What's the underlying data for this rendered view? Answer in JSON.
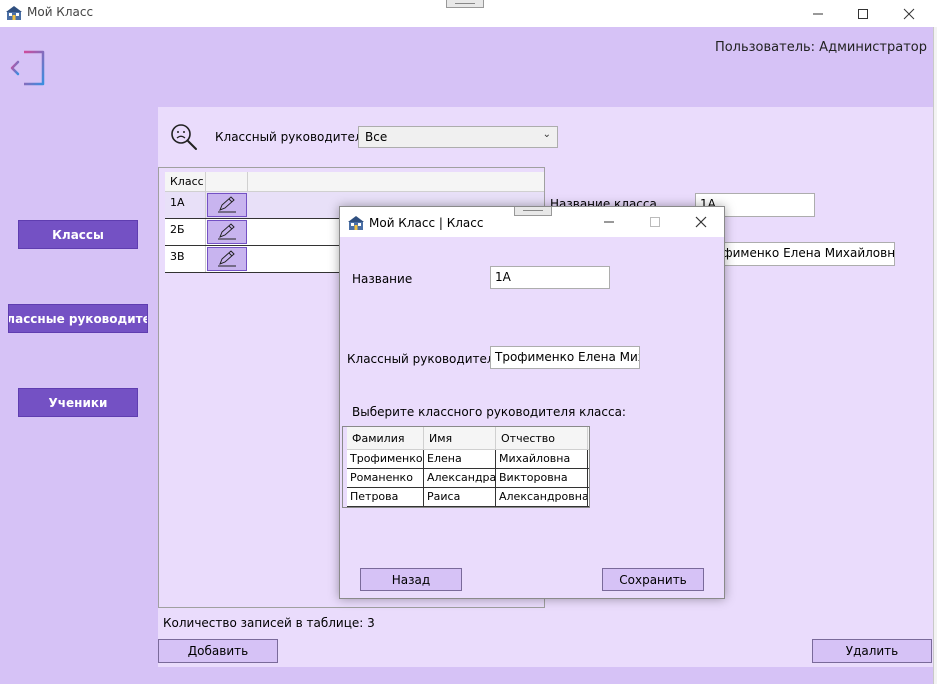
{
  "window": {
    "title": "Мой Класс"
  },
  "header": {
    "user_label": "Пользователь: Администратор"
  },
  "sidebar": {
    "items": [
      {
        "label": "Классы"
      },
      {
        "label": "Классные руководител"
      },
      {
        "label": "Ученики"
      }
    ]
  },
  "filter": {
    "label": "Классный руководитель:",
    "selected": "Все"
  },
  "classes_table": {
    "columns": [
      "Класс"
    ],
    "rows": [
      "1А",
      "2Б",
      "3В"
    ]
  },
  "details": {
    "name_label": "Название класса",
    "name_value": "1А",
    "teacher_value": "офименко Елена Михайловна"
  },
  "footer": {
    "count_label": "Количество записей в таблице: 3",
    "add_label": "Добавить",
    "delete_label": "Удалить"
  },
  "dialog": {
    "title": "Мой Класс | Класс",
    "name_label": "Название",
    "name_value": "1А",
    "teacher_label": "Классный руководитель",
    "teacher_value": "Трофименко Елена Михайл",
    "choose_label": "Выберите классного руководителя класса:",
    "columns": [
      "Фамилия",
      "Имя",
      "Отчество"
    ],
    "rows": [
      [
        "Трофименко",
        "Елена",
        "Михайловна"
      ],
      [
        "Романенко",
        "Александра",
        "Викторовна"
      ],
      [
        "Петрова",
        "Раиса",
        "Александровна"
      ]
    ],
    "back_label": "Назад",
    "save_label": "Сохранить"
  }
}
